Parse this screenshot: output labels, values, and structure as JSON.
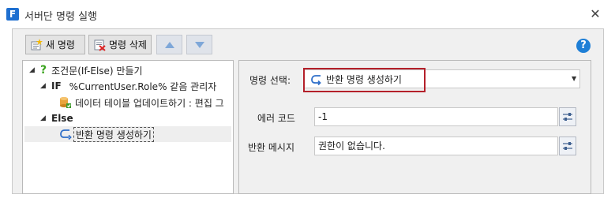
{
  "window": {
    "title": "서버단 명령 실행",
    "logo_letter": "F",
    "close_glyph": "✕"
  },
  "toolbar": {
    "new_label": "새 명령",
    "delete_label": "명령 삭제",
    "help_glyph": "?"
  },
  "tree": {
    "root_label": "조건문(If-Else) 만들기",
    "if_keyword": "IF",
    "if_condition": "%CurrentUser.Role% 같음 관리자",
    "if_child_label": "데이터 테이블 업데이트하기 : 편집 그",
    "else_keyword": "Else",
    "else_child_label": "반환 명령 생성하기",
    "toggle_glyph": "◢"
  },
  "detail": {
    "command_select_label": "명령 선택:",
    "command_select_value": "반환 명령 생성하기",
    "error_code_label": "에러 코드",
    "error_code_value": "-1",
    "return_message_label": "반환 메시지",
    "return_message_value": "권한이 없습니다."
  },
  "colors": {
    "highlight_border": "#b4202a",
    "accent_blue": "#1e7fd6"
  }
}
